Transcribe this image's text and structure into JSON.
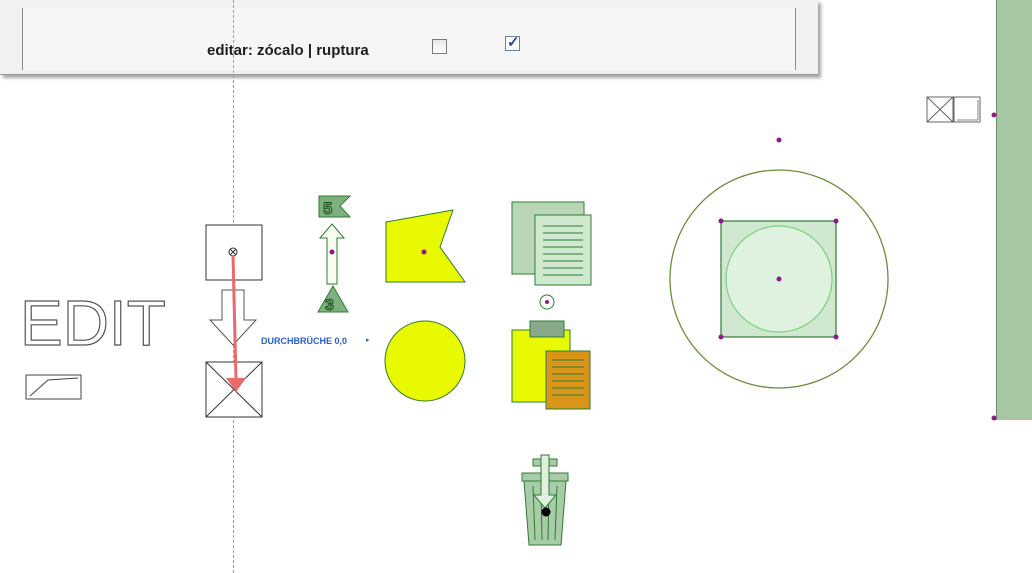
{
  "toolbar": {
    "label": "editar: zócalo | ruptura",
    "checkbox1": false,
    "checkbox2": true
  },
  "canvas": {
    "edit_text": "EDIT",
    "tag_label": "DURCHBRÜCHE 0,0",
    "arrow_top_number": "5",
    "arrow_bottom_number": "3"
  },
  "colors": {
    "accent_purple": "#8b1a8b",
    "fill_yellow": "#e8f900",
    "fill_green_light": "#cfe8cf",
    "stroke_green": "#2e7d32"
  }
}
